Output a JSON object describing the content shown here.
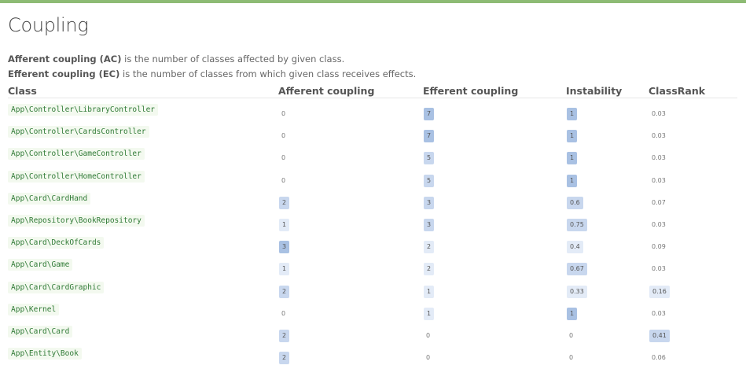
{
  "title": "Coupling",
  "description": {
    "ac_term": "Afferent coupling (AC)",
    "ac_text": " is the number of classes affected by given class.",
    "ec_term": "Efferent coupling (EC)",
    "ec_text": " is the number of classes from which given class receives effects."
  },
  "columns": {
    "class": "Class",
    "afferent": "Afferent coupling",
    "efferent": "Efferent coupling",
    "instability": "Instability",
    "classrank": "ClassRank"
  },
  "colors": {
    "accent_bar": "#8dbb74",
    "class_text": "#2f7a35",
    "badge_strong": "#a9c1e3",
    "badge_medium": "#c8d7ee",
    "badge_light": "#e3ebf7"
  },
  "rows": [
    {
      "class": "App\\Controller\\LibraryController",
      "ac": "0",
      "ec": "7",
      "inst": "1",
      "rank": "0.03"
    },
    {
      "class": "App\\Controller\\CardsController",
      "ac": "0",
      "ec": "7",
      "inst": "1",
      "rank": "0.03"
    },
    {
      "class": "App\\Controller\\GameController",
      "ac": "0",
      "ec": "5",
      "inst": "1",
      "rank": "0.03"
    },
    {
      "class": "App\\Controller\\HomeController",
      "ac": "0",
      "ec": "5",
      "inst": "1",
      "rank": "0.03"
    },
    {
      "class": "App\\Card\\CardHand",
      "ac": "2",
      "ec": "3",
      "inst": "0.6",
      "rank": "0.07"
    },
    {
      "class": "App\\Repository\\BookRepository",
      "ac": "1",
      "ec": "3",
      "inst": "0.75",
      "rank": "0.03"
    },
    {
      "class": "App\\Card\\DeckOfCards",
      "ac": "3",
      "ec": "2",
      "inst": "0.4",
      "rank": "0.09"
    },
    {
      "class": "App\\Card\\Game",
      "ac": "1",
      "ec": "2",
      "inst": "0.67",
      "rank": "0.03"
    },
    {
      "class": "App\\Card\\CardGraphic",
      "ac": "2",
      "ec": "1",
      "inst": "0.33",
      "rank": "0.16"
    },
    {
      "class": "App\\Kernel",
      "ac": "0",
      "ec": "1",
      "inst": "1",
      "rank": "0.03"
    },
    {
      "class": "App\\Card\\Card",
      "ac": "2",
      "ec": "0",
      "inst": "0",
      "rank": "0.41"
    },
    {
      "class": "App\\Entity\\Book",
      "ac": "2",
      "ec": "0",
      "inst": "0",
      "rank": "0.06"
    }
  ]
}
